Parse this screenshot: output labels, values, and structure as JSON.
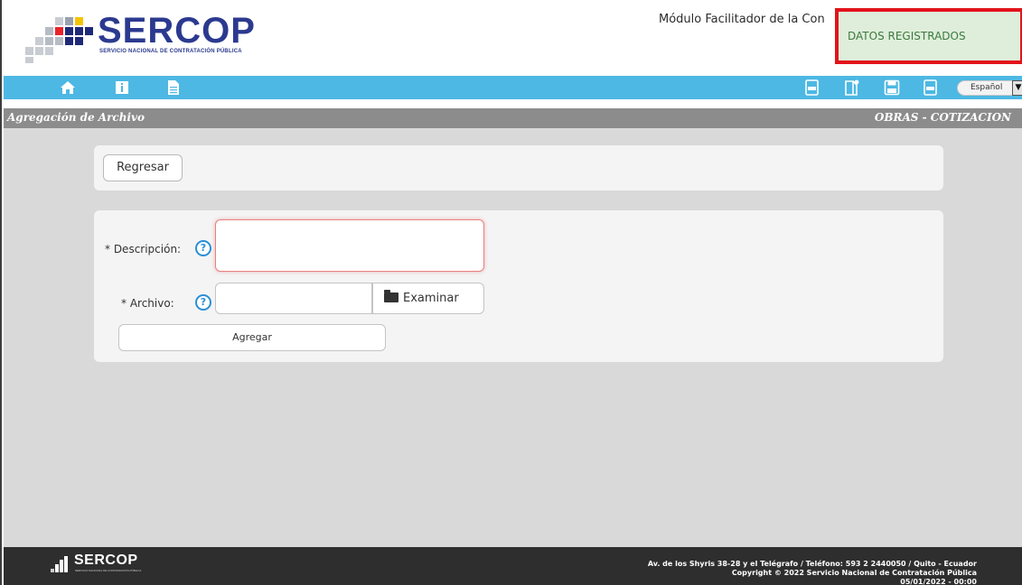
{
  "header": {
    "logo_text": "SERCOP",
    "logo_subtitle": "SERVICIO NACIONAL DE CONTRATACIÓN PÚBLICA",
    "module_title": "Módulo Facilitador de la Con"
  },
  "toast": {
    "message": "DATOS REGISTRADOS"
  },
  "toolbar": {
    "left_icons": [
      "home-icon",
      "info-icon",
      "document-icon"
    ],
    "right_icons": [
      "pdf-icon",
      "new-document-icon",
      "save-icon",
      "pdf-export-icon"
    ],
    "language": "Español"
  },
  "section": {
    "title": "Agregación de Archivo",
    "context": "OBRAS - COTIZACION"
  },
  "actions": {
    "back_label": "Regresar",
    "add_label": "Agregar",
    "browse_label": "Examinar"
  },
  "form": {
    "description_label": "* Descripción:",
    "description_value": "",
    "file_label": "* Archivo:",
    "file_value": "",
    "help_glyph": "?"
  },
  "footer": {
    "logo_text": "SERCOP",
    "address": "Av. de los Shyris 38-28 y el Telégrafo / Teléfono: 593 2 2440050 / Quito - Ecuador",
    "copyright": "Copyright © 2022 Servicio Nacional de Contratación Pública",
    "datetime": "05/01/2022 - 00:00"
  },
  "colors": {
    "toolbar": "#4db8e3",
    "section_bar": "#8c8c8c",
    "content_bg": "#d9d9d9",
    "toast_bg": "#dfeedb",
    "toast_border": "#e3131b",
    "logo_blue": "#2b3a8f",
    "help_blue": "#2a8fd6",
    "footer_bg": "#2e2e2e"
  }
}
